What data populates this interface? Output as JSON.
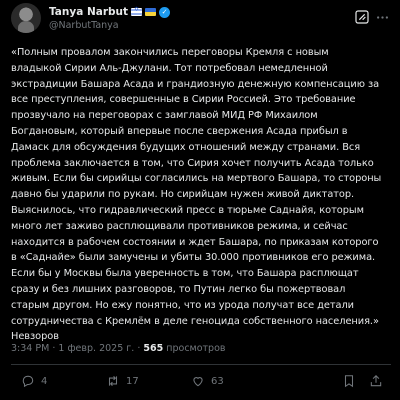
{
  "author": {
    "display_name": "Tanya Narbut",
    "handle": "@NarbutTanya",
    "flags": [
      "israel-flag",
      "ukraine-flag"
    ],
    "verified": true
  },
  "tweet": {
    "text": "«Полным провалом закончились переговоры Кремля с новым\nвладыкой Сирии Аль-Джулани. Тот потребовал немедленной\nэкстрадиции Башара Асада и грандиозную денежную компенсацию за\nвсе преступления, совершенные в Сирии Россией. Это требование\nпрозвучало на переговорах с замглавой МИД РФ Михаилом\nБогдановым, который впервые после свержения Асада прибыл в\nДамаск для обсуждения будущих отношений между странами. Вся\nпроблема заключается в том, что Сирия хочет получить Асада только\nживым. Если бы сирийцы согласились на мертвого Башара, то стороны\nдавно бы ударили по рукам. Но сирийцам нужен живой диктатор.\nВыяснилось, что гидравлический пресс в тюрьме Саднайя, которым\nмного лет заживо расплющивали противников режима, и сейчас\nнаходится в рабочем состоянии и ждет Башара, по приказам которого\nв «Саднайе» были замучены и убиты 30.000 противников его режима.\nЕсли бы у Москвы была уверенность в том, что Башара расплющат\nсразу и без лишних разговоров, то Путин легко бы пожертвовал\nстарым другом. Но ежу понятно, что из урода получат все детали\nсотрудничества с Кремлём в деле геноцида собственного населения.»\nНевзоров",
    "time": "3:34 PM",
    "date": "1 февр. 2025 г.",
    "separator": "·",
    "views_count": "565",
    "views_label": "просмотров"
  },
  "actions": {
    "replies": "4",
    "reposts": "17",
    "likes": "63"
  },
  "icons": [
    "grok-icon",
    "more-icon",
    "reply-icon",
    "repost-icon",
    "like-icon",
    "bookmark-icon",
    "share-icon"
  ],
  "colors": {
    "background": "#000000",
    "text": "#e7e9ea",
    "secondary": "#71767b",
    "accent": "#1d9bf0"
  }
}
